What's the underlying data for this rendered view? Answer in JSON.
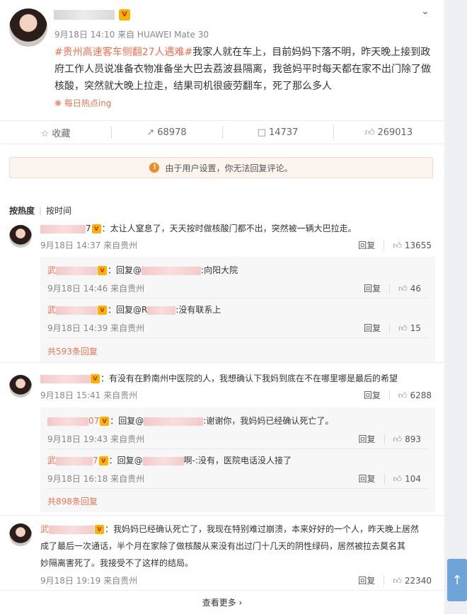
{
  "post": {
    "meta": "9月18日 14:10 来自 HUAWEI Mate 30",
    "hashtag": "#贵州高速客车侧翻27人遇难#",
    "body": "我家人就在车上，目前妈妈下落不明，昨天晚上接到政府工作人员说准备衣物准备坐大巴去荔波县隔离，我爸妈平时每天都在家不出门除了做核酸，突然就大晚上拉走，结果司机很疲劳翻车，死了那么多人",
    "hot_tag": "每日热点ing"
  },
  "actions": {
    "favorite": "收藏",
    "forward": "68978",
    "comment": "14737",
    "like": "269013"
  },
  "notice": "由于用户设置，你无法回复评论。",
  "sort": {
    "hot": "按热度",
    "time": "按时间"
  },
  "comments": [
    {
      "name_suffix": "7",
      "text": "：太让人窒息了，天天按时做核酸门都不出，突然被一辆大巴拉走。",
      "meta": "9月18日 14:37 来自贵州",
      "reply_label": "回复",
      "likes": "13655",
      "replies": [
        {
          "prefix": "武",
          "text": "：回复@",
          "tail": ":向阳大院",
          "meta": "9月18日 14:46 来自贵州",
          "reply_label": "回复",
          "likes": "46"
        },
        {
          "prefix": "武",
          "text": "：回复@R",
          "tail": ":没有联系上",
          "meta": "9月18日 14:39 来自贵州",
          "reply_label": "回复",
          "likes": "15"
        }
      ],
      "more": "共593条回复"
    },
    {
      "name_suffix": "",
      "text": "：有没有在黔南州中医院的人，我想确认下我妈到底在不在哪里哪是最后的希望",
      "meta": "9月18日 15:41 来自贵州",
      "reply_label": "回复",
      "likes": "6288",
      "replies": [
        {
          "prefix": "",
          "name_suffix": "07",
          "text": "：回复@",
          "tail": ":谢谢你，我妈妈已经确认死亡了。",
          "meta": "9月18日 19:43 来自贵州",
          "reply_label": "回复",
          "likes": "893"
        },
        {
          "prefix": "武",
          "name_suffix": "7",
          "text": "：回复@",
          "tail": "啊-:没有，医院电话没人接了",
          "meta": "9月18日 16:18 来自贵州",
          "reply_label": "回复",
          "likes": "104"
        }
      ],
      "more": "共898条回复"
    },
    {
      "name_prefix": "武",
      "text_line1": "：我妈妈已经确认死亡了，我现在特别难过崩溃，本来好好的一个人，昨天晚上居然",
      "text_line2": "成了最后一次通话，半个月在家除了做核酸从来没有出过门十几天的阴性绿码，居然被拉去莫名其",
      "text_line3": "妙隔离害死了。我接受不了这样的结局。",
      "meta": "9月18日 19:19 来自贵州",
      "reply_label": "回复",
      "likes": "22340"
    }
  ],
  "view_more": "查看更多 ›",
  "icons": {
    "favorite": "star-icon",
    "forward": "forward-icon",
    "comment": "comment-icon",
    "like": "thumb-up-icon"
  }
}
